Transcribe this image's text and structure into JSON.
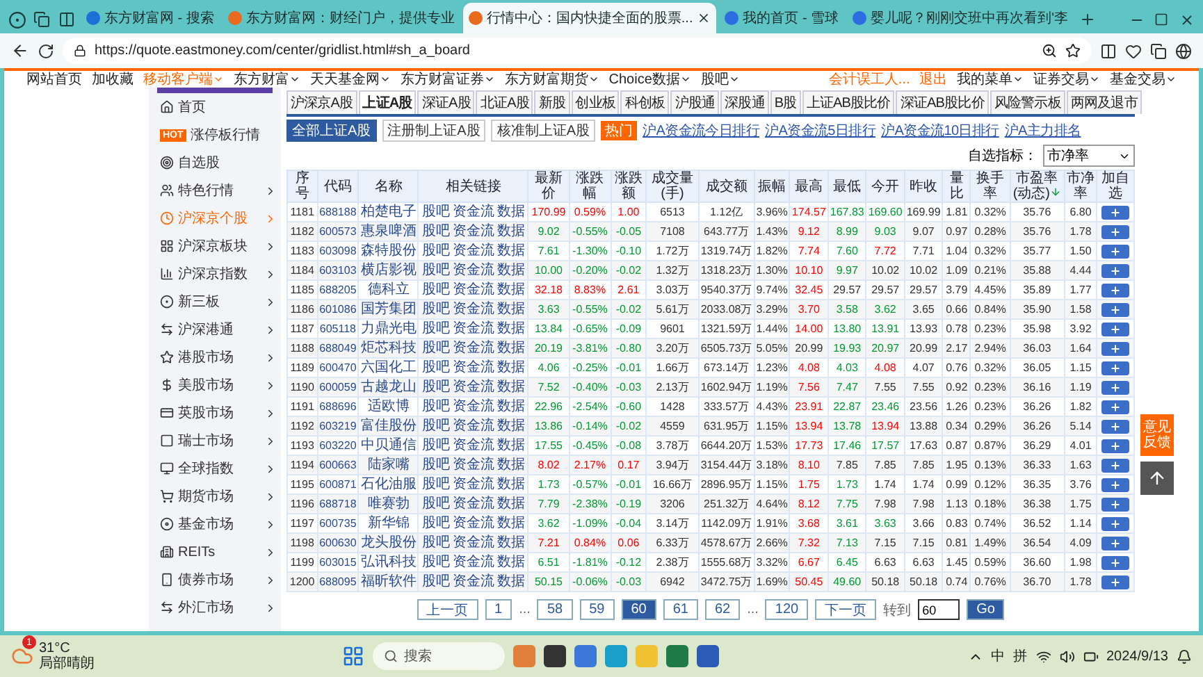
{
  "browser": {
    "tabs": [
      {
        "title": "东方财富网 - 搜索",
        "selected": false
      },
      {
        "title": "东方财富网：财经门户，提供专业",
        "selected": false
      },
      {
        "title": "行情中心：国内快捷全面的股票...",
        "selected": true
      },
      {
        "title": "我的首页 - 雪球",
        "selected": false
      },
      {
        "title": "婴儿呢？刚刚交班中再次看到'李",
        "selected": false
      }
    ],
    "url": "https://quote.eastmoney.com/center/gridlist.html#sh_a_board"
  },
  "site_nav": {
    "left": [
      {
        "label": "网站首页",
        "menu": false,
        "highlight": false
      },
      {
        "label": "加收藏",
        "menu": false,
        "highlight": false
      },
      {
        "label": "移动客户端",
        "menu": true,
        "highlight": true
      },
      {
        "label": "东方财富",
        "menu": true,
        "highlight": false
      },
      {
        "label": "天天基金网",
        "menu": true,
        "highlight": false
      },
      {
        "label": "东方财富证券",
        "menu": true,
        "highlight": false
      },
      {
        "label": "东方财富期货",
        "menu": true,
        "highlight": false
      },
      {
        "label": "Choice数据",
        "menu": true,
        "highlight": false
      },
      {
        "label": "股吧",
        "menu": true,
        "highlight": false
      }
    ],
    "right": [
      {
        "label": "会计误工人...",
        "menu": false,
        "highlight": true
      },
      {
        "label": "退出",
        "menu": false,
        "highlight": true
      },
      {
        "label": "我的菜单",
        "menu": true,
        "highlight": false
      },
      {
        "label": "证券交易",
        "menu": true,
        "highlight": false
      },
      {
        "label": "基金交易",
        "menu": true,
        "highlight": false
      }
    ]
  },
  "sidebar": {
    "items": [
      {
        "label": "首页",
        "selected": false,
        "expandable": false
      },
      {
        "label": "涨停板行情",
        "selected": false,
        "expandable": false,
        "badge": "HOT"
      },
      {
        "label": "自选股",
        "selected": false,
        "expandable": false
      },
      {
        "label": "特色行情",
        "selected": false,
        "expandable": true
      },
      {
        "label": "沪深京个股",
        "selected": true,
        "expandable": true
      },
      {
        "label": "沪深京板块",
        "selected": false,
        "expandable": true
      },
      {
        "label": "沪深京指数",
        "selected": false,
        "expandable": true
      },
      {
        "label": "新三板",
        "selected": false,
        "expandable": true
      },
      {
        "label": "沪深港通",
        "selected": false,
        "expandable": true
      },
      {
        "label": "港股市场",
        "selected": false,
        "expandable": true
      },
      {
        "label": "美股市场",
        "selected": false,
        "expandable": true
      },
      {
        "label": "英股市场",
        "selected": false,
        "expandable": true
      },
      {
        "label": "瑞士市场",
        "selected": false,
        "expandable": true
      },
      {
        "label": "全球指数",
        "selected": false,
        "expandable": true
      },
      {
        "label": "期货市场",
        "selected": false,
        "expandable": true
      },
      {
        "label": "基金市场",
        "selected": false,
        "expandable": true
      },
      {
        "label": "REITs",
        "selected": false,
        "expandable": true
      },
      {
        "label": "债券市场",
        "selected": false,
        "expandable": true
      },
      {
        "label": "外汇市场",
        "selected": false,
        "expandable": true
      }
    ]
  },
  "market_tabs": [
    {
      "label": "沪深京A股",
      "selected": false
    },
    {
      "label": "上证A股",
      "selected": true
    },
    {
      "label": "深证A股",
      "selected": false
    },
    {
      "label": "北证A股",
      "selected": false
    },
    {
      "label": "新股",
      "selected": false
    },
    {
      "label": "创业板",
      "selected": false
    },
    {
      "label": "科创板",
      "selected": false
    },
    {
      "label": "沪股通",
      "selected": false
    },
    {
      "label": "深股通",
      "selected": false
    },
    {
      "label": "B股",
      "selected": false
    },
    {
      "label": "上证AB股比价",
      "selected": false
    },
    {
      "label": "深证AB股比价",
      "selected": false
    },
    {
      "label": "风险警示板",
      "selected": false
    },
    {
      "label": "两网及退市",
      "selected": false
    }
  ],
  "filters": {
    "buttons": [
      {
        "label": "全部上证A股",
        "selected": true
      },
      {
        "label": "注册制上证A股",
        "selected": false
      },
      {
        "label": "核准制上证A股",
        "selected": false
      }
    ],
    "hot_badge": "热门",
    "links": [
      "沪A资金流今日排行",
      "沪A资金流5日排行",
      "沪A资金流10日排行",
      "沪A主力排名"
    ],
    "indicator_label": "自选指标：",
    "indicator_value": "市净率"
  },
  "table": {
    "columns": [
      {
        "label": "序号",
        "sorted": false
      },
      {
        "label": "代码",
        "sorted": false
      },
      {
        "label": "名称",
        "sorted": false
      },
      {
        "label": "相关链接",
        "sorted": false
      },
      {
        "label": "最新价",
        "sorted": false
      },
      {
        "label": "涨跌幅",
        "sorted": false
      },
      {
        "label": "涨跌额",
        "sorted": false
      },
      {
        "label": "成交量(手)",
        "sorted": false
      },
      {
        "label": "成交额",
        "sorted": false
      },
      {
        "label": "振幅",
        "sorted": false
      },
      {
        "label": "最高",
        "sorted": false
      },
      {
        "label": "最低",
        "sorted": false
      },
      {
        "label": "今开",
        "sorted": false
      },
      {
        "label": "昨收",
        "sorted": false
      },
      {
        "label": "量比",
        "sorted": false
      },
      {
        "label": "换手率",
        "sorted": false
      },
      {
        "label": "市盈率(动态)",
        "sorted": true
      },
      {
        "label": "市净率",
        "sorted": false
      },
      {
        "label": "加自选",
        "sorted": false
      }
    ],
    "rows": [
      {
        "no": "1181",
        "code": "688188",
        "name": "柏楚电子",
        "links": [
          "股吧",
          "资金流",
          "数据"
        ],
        "price": {
          "text": "170.99",
          "color": "#ff0000"
        },
        "pct": {
          "text": "0.59%",
          "color": "#ff0000"
        },
        "chg": {
          "text": "1.00",
          "color": "#ff0000"
        },
        "vol": "6513",
        "amount": "1.12亿",
        "amp": "3.96%",
        "high": {
          "text": "174.57",
          "color": "#ff0000"
        },
        "low": {
          "text": "167.83",
          "color": "#009933"
        },
        "open": {
          "text": "169.60",
          "color": "#009933"
        },
        "prev": "169.99",
        "vr": "1.81",
        "turn": "0.32%",
        "pe": "35.76",
        "pb": "6.80"
      },
      {
        "no": "1182",
        "code": "600573",
        "name": "惠泉啤酒",
        "links": [
          "股吧",
          "资金流",
          "数据"
        ],
        "price": {
          "text": "9.02",
          "color": "#009933"
        },
        "pct": {
          "text": "-0.55%",
          "color": "#009933"
        },
        "chg": {
          "text": "-0.05",
          "color": "#009933"
        },
        "vol": "7108",
        "amount": "643.77万",
        "amp": "1.43%",
        "high": {
          "text": "9.12",
          "color": "#ff0000"
        },
        "low": {
          "text": "8.99",
          "color": "#009933"
        },
        "open": {
          "text": "9.03",
          "color": "#009933"
        },
        "prev": "9.07",
        "vr": "0.97",
        "turn": "0.28%",
        "pe": "35.76",
        "pb": "1.78"
      },
      {
        "no": "1183",
        "code": "603098",
        "name": "森特股份",
        "links": [
          "股吧",
          "资金流",
          "数据"
        ],
        "price": {
          "text": "7.61",
          "color": "#009933"
        },
        "pct": {
          "text": "-1.30%",
          "color": "#009933"
        },
        "chg": {
          "text": "-0.10",
          "color": "#009933"
        },
        "vol": "1.72万",
        "amount": "1319.74万",
        "amp": "1.82%",
        "high": {
          "text": "7.74",
          "color": "#ff0000"
        },
        "low": {
          "text": "7.60",
          "color": "#009933"
        },
        "open": {
          "text": "7.72",
          "color": "#ff0000"
        },
        "prev": "7.71",
        "vr": "1.04",
        "turn": "0.32%",
        "pe": "35.77",
        "pb": "1.50"
      },
      {
        "no": "1184",
        "code": "603103",
        "name": "横店影视",
        "links": [
          "股吧",
          "资金流",
          "数据"
        ],
        "price": {
          "text": "10.00",
          "color": "#009933"
        },
        "pct": {
          "text": "-0.20%",
          "color": "#009933"
        },
        "chg": {
          "text": "-0.02",
          "color": "#009933"
        },
        "vol": "1.32万",
        "amount": "1318.23万",
        "amp": "1.30%",
        "high": {
          "text": "10.10",
          "color": "#ff0000"
        },
        "low": {
          "text": "9.97",
          "color": "#009933"
        },
        "open": {
          "text": "10.02",
          "color": "#333333"
        },
        "prev": "10.02",
        "vr": "1.09",
        "turn": "0.21%",
        "pe": "35.88",
        "pb": "4.44"
      },
      {
        "no": "1185",
        "code": "688205",
        "name": "德科立",
        "links": [
          "股吧",
          "资金流",
          "数据"
        ],
        "price": {
          "text": "32.18",
          "color": "#ff0000"
        },
        "pct": {
          "text": "8.83%",
          "color": "#ff0000"
        },
        "chg": {
          "text": "2.61",
          "color": "#ff0000"
        },
        "vol": "3.03万",
        "amount": "9540.37万",
        "amp": "9.74%",
        "high": {
          "text": "32.45",
          "color": "#ff0000"
        },
        "low": {
          "text": "29.57",
          "color": "#333333"
        },
        "open": {
          "text": "29.57",
          "color": "#333333"
        },
        "prev": "29.57",
        "vr": "3.79",
        "turn": "4.45%",
        "pe": "35.89",
        "pb": "1.77"
      },
      {
        "no": "1186",
        "code": "601086",
        "name": "国芳集团",
        "links": [
          "股吧",
          "资金流",
          "数据"
        ],
        "price": {
          "text": "3.63",
          "color": "#009933"
        },
        "pct": {
          "text": "-0.55%",
          "color": "#009933"
        },
        "chg": {
          "text": "-0.02",
          "color": "#009933"
        },
        "vol": "5.61万",
        "amount": "2033.08万",
        "amp": "3.29%",
        "high": {
          "text": "3.70",
          "color": "#ff0000"
        },
        "low": {
          "text": "3.58",
          "color": "#009933"
        },
        "open": {
          "text": "3.62",
          "color": "#009933"
        },
        "prev": "3.65",
        "vr": "0.66",
        "turn": "0.84%",
        "pe": "35.90",
        "pb": "1.58"
      },
      {
        "no": "1187",
        "code": "605118",
        "name": "力鼎光电",
        "links": [
          "股吧",
          "资金流",
          "数据"
        ],
        "price": {
          "text": "13.84",
          "color": "#009933"
        },
        "pct": {
          "text": "-0.65%",
          "color": "#009933"
        },
        "chg": {
          "text": "-0.09",
          "color": "#009933"
        },
        "vol": "9601",
        "amount": "1321.59万",
        "amp": "1.44%",
        "high": {
          "text": "14.00",
          "color": "#ff0000"
        },
        "low": {
          "text": "13.80",
          "color": "#009933"
        },
        "open": {
          "text": "13.91",
          "color": "#009933"
        },
        "prev": "13.93",
        "vr": "0.78",
        "turn": "0.23%",
        "pe": "35.98",
        "pb": "3.92"
      },
      {
        "no": "1188",
        "code": "688049",
        "name": "炬芯科技",
        "links": [
          "股吧",
          "资金流",
          "数据"
        ],
        "price": {
          "text": "20.19",
          "color": "#009933"
        },
        "pct": {
          "text": "-3.81%",
          "color": "#009933"
        },
        "chg": {
          "text": "-0.80",
          "color": "#009933"
        },
        "vol": "3.20万",
        "amount": "6505.73万",
        "amp": "5.05%",
        "high": {
          "text": "20.99",
          "color": "#333333"
        },
        "low": {
          "text": "19.93",
          "color": "#009933"
        },
        "open": {
          "text": "20.97",
          "color": "#009933"
        },
        "prev": "20.99",
        "vr": "2.17",
        "turn": "2.94%",
        "pe": "36.03",
        "pb": "1.64"
      },
      {
        "no": "1189",
        "code": "600470",
        "name": "六国化工",
        "links": [
          "股吧",
          "资金流",
          "数据"
        ],
        "price": {
          "text": "4.06",
          "color": "#009933"
        },
        "pct": {
          "text": "-0.25%",
          "color": "#009933"
        },
        "chg": {
          "text": "-0.01",
          "color": "#009933"
        },
        "vol": "1.66万",
        "amount": "673.14万",
        "amp": "1.23%",
        "high": {
          "text": "4.08",
          "color": "#ff0000"
        },
        "low": {
          "text": "4.03",
          "color": "#009933"
        },
        "open": {
          "text": "4.08",
          "color": "#ff0000"
        },
        "prev": "4.07",
        "vr": "0.76",
        "turn": "0.32%",
        "pe": "36.05",
        "pb": "1.15"
      },
      {
        "no": "1190",
        "code": "600059",
        "name": "古越龙山",
        "links": [
          "股吧",
          "资金流",
          "数据"
        ],
        "price": {
          "text": "7.52",
          "color": "#009933"
        },
        "pct": {
          "text": "-0.40%",
          "color": "#009933"
        },
        "chg": {
          "text": "-0.03",
          "color": "#009933"
        },
        "vol": "2.13万",
        "amount": "1602.94万",
        "amp": "1.19%",
        "high": {
          "text": "7.56",
          "color": "#ff0000"
        },
        "low": {
          "text": "7.47",
          "color": "#009933"
        },
        "open": {
          "text": "7.55",
          "color": "#333333"
        },
        "prev": "7.55",
        "vr": "0.92",
        "turn": "0.23%",
        "pe": "36.16",
        "pb": "1.19"
      },
      {
        "no": "1191",
        "code": "688696",
        "name": "适欧博",
        "links": [
          "股吧",
          "资金流",
          "数据"
        ],
        "price": {
          "text": "22.96",
          "color": "#009933"
        },
        "pct": {
          "text": "-2.54%",
          "color": "#009933"
        },
        "chg": {
          "text": "-0.60",
          "color": "#009933"
        },
        "vol": "1428",
        "amount": "333.57万",
        "amp": "4.43%",
        "high": {
          "text": "23.91",
          "color": "#ff0000"
        },
        "low": {
          "text": "22.87",
          "color": "#009933"
        },
        "open": {
          "text": "23.46",
          "color": "#009933"
        },
        "prev": "23.56",
        "vr": "1.26",
        "turn": "0.23%",
        "pe": "36.26",
        "pb": "1.82"
      },
      {
        "no": "1192",
        "code": "603219",
        "name": "富佳股份",
        "links": [
          "股吧",
          "资金流",
          "数据"
        ],
        "price": {
          "text": "13.86",
          "color": "#009933"
        },
        "pct": {
          "text": "-0.14%",
          "color": "#009933"
        },
        "chg": {
          "text": "-0.02",
          "color": "#009933"
        },
        "vol": "4559",
        "amount": "631.95万",
        "amp": "1.15%",
        "high": {
          "text": "13.94",
          "color": "#ff0000"
        },
        "low": {
          "text": "13.78",
          "color": "#009933"
        },
        "open": {
          "text": "13.94",
          "color": "#ff0000"
        },
        "prev": "13.88",
        "vr": "0.34",
        "turn": "0.29%",
        "pe": "36.26",
        "pb": "5.14"
      },
      {
        "no": "1193",
        "code": "603220",
        "name": "中贝通信",
        "links": [
          "股吧",
          "资金流",
          "数据"
        ],
        "price": {
          "text": "17.55",
          "color": "#009933"
        },
        "pct": {
          "text": "-0.45%",
          "color": "#009933"
        },
        "chg": {
          "text": "-0.08",
          "color": "#009933"
        },
        "vol": "3.78万",
        "amount": "6644.20万",
        "amp": "1.53%",
        "high": {
          "text": "17.73",
          "color": "#ff0000"
        },
        "low": {
          "text": "17.46",
          "color": "#009933"
        },
        "open": {
          "text": "17.57",
          "color": "#009933"
        },
        "prev": "17.63",
        "vr": "0.87",
        "turn": "0.87%",
        "pe": "36.29",
        "pb": "4.01"
      },
      {
        "no": "1194",
        "code": "600663",
        "name": "陆家嘴",
        "links": [
          "股吧",
          "资金流",
          "数据"
        ],
        "price": {
          "text": "8.02",
          "color": "#ff0000"
        },
        "pct": {
          "text": "2.17%",
          "color": "#ff0000"
        },
        "chg": {
          "text": "0.17",
          "color": "#ff0000"
        },
        "vol": "3.94万",
        "amount": "3154.44万",
        "amp": "3.18%",
        "high": {
          "text": "8.10",
          "color": "#ff0000"
        },
        "low": {
          "text": "7.85",
          "color": "#333333"
        },
        "open": {
          "text": "7.85",
          "color": "#333333"
        },
        "prev": "7.85",
        "vr": "1.95",
        "turn": "0.13%",
        "pe": "36.33",
        "pb": "1.63"
      },
      {
        "no": "1195",
        "code": "600871",
        "name": "石化油服",
        "links": [
          "股吧",
          "资金流",
          "数据"
        ],
        "price": {
          "text": "1.73",
          "color": "#009933"
        },
        "pct": {
          "text": "-0.57%",
          "color": "#009933"
        },
        "chg": {
          "text": "-0.01",
          "color": "#009933"
        },
        "vol": "16.66万",
        "amount": "2896.95万",
        "amp": "1.15%",
        "high": {
          "text": "1.75",
          "color": "#ff0000"
        },
        "low": {
          "text": "1.73",
          "color": "#009933"
        },
        "open": {
          "text": "1.74",
          "color": "#333333"
        },
        "prev": "1.74",
        "vr": "0.99",
        "turn": "0.12%",
        "pe": "36.35",
        "pb": "3.76"
      },
      {
        "no": "1196",
        "code": "688718",
        "name": "唯赛勃",
        "links": [
          "股吧",
          "资金流",
          "数据"
        ],
        "price": {
          "text": "7.79",
          "color": "#009933"
        },
        "pct": {
          "text": "-2.38%",
          "color": "#009933"
        },
        "chg": {
          "text": "-0.19",
          "color": "#009933"
        },
        "vol": "3206",
        "amount": "251.32万",
        "amp": "4.64%",
        "high": {
          "text": "8.12",
          "color": "#ff0000"
        },
        "low": {
          "text": "7.75",
          "color": "#009933"
        },
        "open": {
          "text": "7.98",
          "color": "#333333"
        },
        "prev": "7.98",
        "vr": "1.13",
        "turn": "0.18%",
        "pe": "36.38",
        "pb": "1.75"
      },
      {
        "no": "1197",
        "code": "600735",
        "name": "新华锦",
        "links": [
          "股吧",
          "资金流",
          "数据"
        ],
        "price": {
          "text": "3.62",
          "color": "#009933"
        },
        "pct": {
          "text": "-1.09%",
          "color": "#009933"
        },
        "chg": {
          "text": "-0.04",
          "color": "#009933"
        },
        "vol": "3.14万",
        "amount": "1142.09万",
        "amp": "1.91%",
        "high": {
          "text": "3.68",
          "color": "#ff0000"
        },
        "low": {
          "text": "3.61",
          "color": "#009933"
        },
        "open": {
          "text": "3.63",
          "color": "#009933"
        },
        "prev": "3.66",
        "vr": "0.83",
        "turn": "0.74%",
        "pe": "36.52",
        "pb": "1.14"
      },
      {
        "no": "1198",
        "code": "600630",
        "name": "龙头股份",
        "links": [
          "股吧",
          "资金流",
          "数据"
        ],
        "price": {
          "text": "7.21",
          "color": "#ff0000"
        },
        "pct": {
          "text": "0.84%",
          "color": "#ff0000"
        },
        "chg": {
          "text": "0.06",
          "color": "#ff0000"
        },
        "vol": "6.33万",
        "amount": "4578.67万",
        "amp": "2.66%",
        "high": {
          "text": "7.32",
          "color": "#ff0000"
        },
        "low": {
          "text": "7.13",
          "color": "#009933"
        },
        "open": {
          "text": "7.15",
          "color": "#333333"
        },
        "prev": "7.15",
        "vr": "0.81",
        "turn": "1.49%",
        "pe": "36.54",
        "pb": "4.09"
      },
      {
        "no": "1199",
        "code": "603015",
        "name": "弘讯科技",
        "links": [
          "股吧",
          "资金流",
          "数据"
        ],
        "price": {
          "text": "6.51",
          "color": "#009933"
        },
        "pct": {
          "text": "-1.81%",
          "color": "#009933"
        },
        "chg": {
          "text": "-0.12",
          "color": "#009933"
        },
        "vol": "2.38万",
        "amount": "1555.68万",
        "amp": "3.32%",
        "high": {
          "text": "6.67",
          "color": "#ff0000"
        },
        "low": {
          "text": "6.45",
          "color": "#009933"
        },
        "open": {
          "text": "6.63",
          "color": "#333333"
        },
        "prev": "6.63",
        "vr": "1.45",
        "turn": "0.59%",
        "pe": "36.60",
        "pb": "1.98"
      },
      {
        "no": "1200",
        "code": "688095",
        "name": "福昕软件",
        "links": [
          "股吧",
          "资金流",
          "数据"
        ],
        "price": {
          "text": "50.15",
          "color": "#009933"
        },
        "pct": {
          "text": "-0.06%",
          "color": "#009933"
        },
        "chg": {
          "text": "-0.03",
          "color": "#009933"
        },
        "vol": "6942",
        "amount": "3472.75万",
        "amp": "1.69%",
        "high": {
          "text": "50.45",
          "color": "#ff0000"
        },
        "low": {
          "text": "49.60",
          "color": "#009933"
        },
        "open": {
          "text": "50.18",
          "color": "#333333"
        },
        "prev": "50.18",
        "vr": "0.74",
        "turn": "0.76%",
        "pe": "36.70",
        "pb": "1.78"
      }
    ]
  },
  "pagination": {
    "items": [
      {
        "label": "上一页",
        "kind": "nav"
      },
      {
        "label": "1",
        "kind": "page",
        "selected": false
      },
      {
        "label": "...",
        "kind": "gap"
      },
      {
        "label": "58",
        "kind": "page",
        "selected": false
      },
      {
        "label": "59",
        "kind": "page",
        "selected": false
      },
      {
        "label": "60",
        "kind": "page",
        "selected": true
      },
      {
        "label": "61",
        "kind": "page",
        "selected": false
      },
      {
        "label": "62",
        "kind": "page",
        "selected": false
      },
      {
        "label": "...",
        "kind": "gap"
      },
      {
        "label": "120",
        "kind": "page",
        "selected": false
      },
      {
        "label": "下一页",
        "kind": "nav"
      }
    ],
    "goto_label": "转到",
    "goto_value": "60",
    "go_button": "Go"
  },
  "float": {
    "feedback": "意见反馈"
  },
  "taskbar": {
    "temperature": "31°C",
    "weather": "局部晴朗",
    "notification_count": "1",
    "search_placeholder": "搜索",
    "ime_mode": "中",
    "ime": "拼",
    "date": "2024/9/13"
  }
}
